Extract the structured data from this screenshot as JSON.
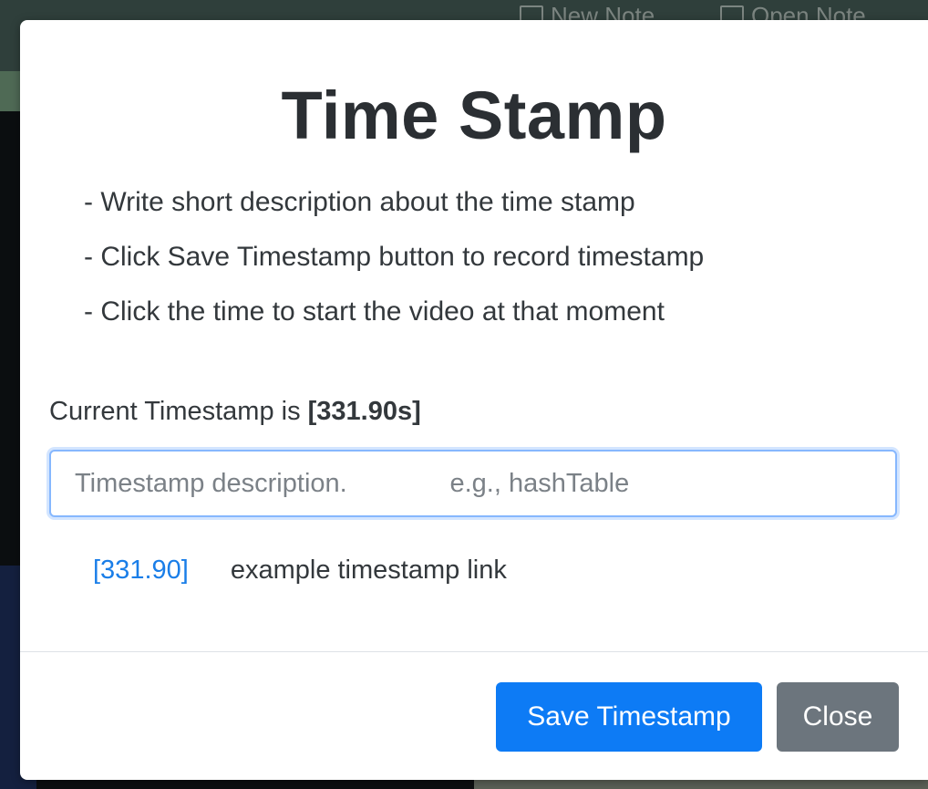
{
  "background": {
    "nav_new_note": "New Note",
    "nav_open_note": "Open Note"
  },
  "modal": {
    "title": "Time Stamp",
    "instructions": [
      "- Write short description about the time stamp",
      "- Click Save Timestamp button to record timestamp",
      "- Click the time to start the video at that moment"
    ],
    "current_timestamp_prefix": "Current Timestamp is ",
    "current_timestamp_value": "[331.90s]",
    "input": {
      "placeholder": "Timestamp description.              e.g., hashTable",
      "value": ""
    },
    "example": {
      "link_text": "[331.90]",
      "label": "example timestamp link"
    },
    "buttons": {
      "save_label": "Save Timestamp",
      "close_label": "Close"
    }
  },
  "colors": {
    "primary": "#0d7bf5",
    "secondary": "#6c757d",
    "link": "#1a7ee8",
    "input_focus_border": "#86b7fe"
  },
  "icons": [
    "new-note-icon",
    "open-note-icon"
  ]
}
